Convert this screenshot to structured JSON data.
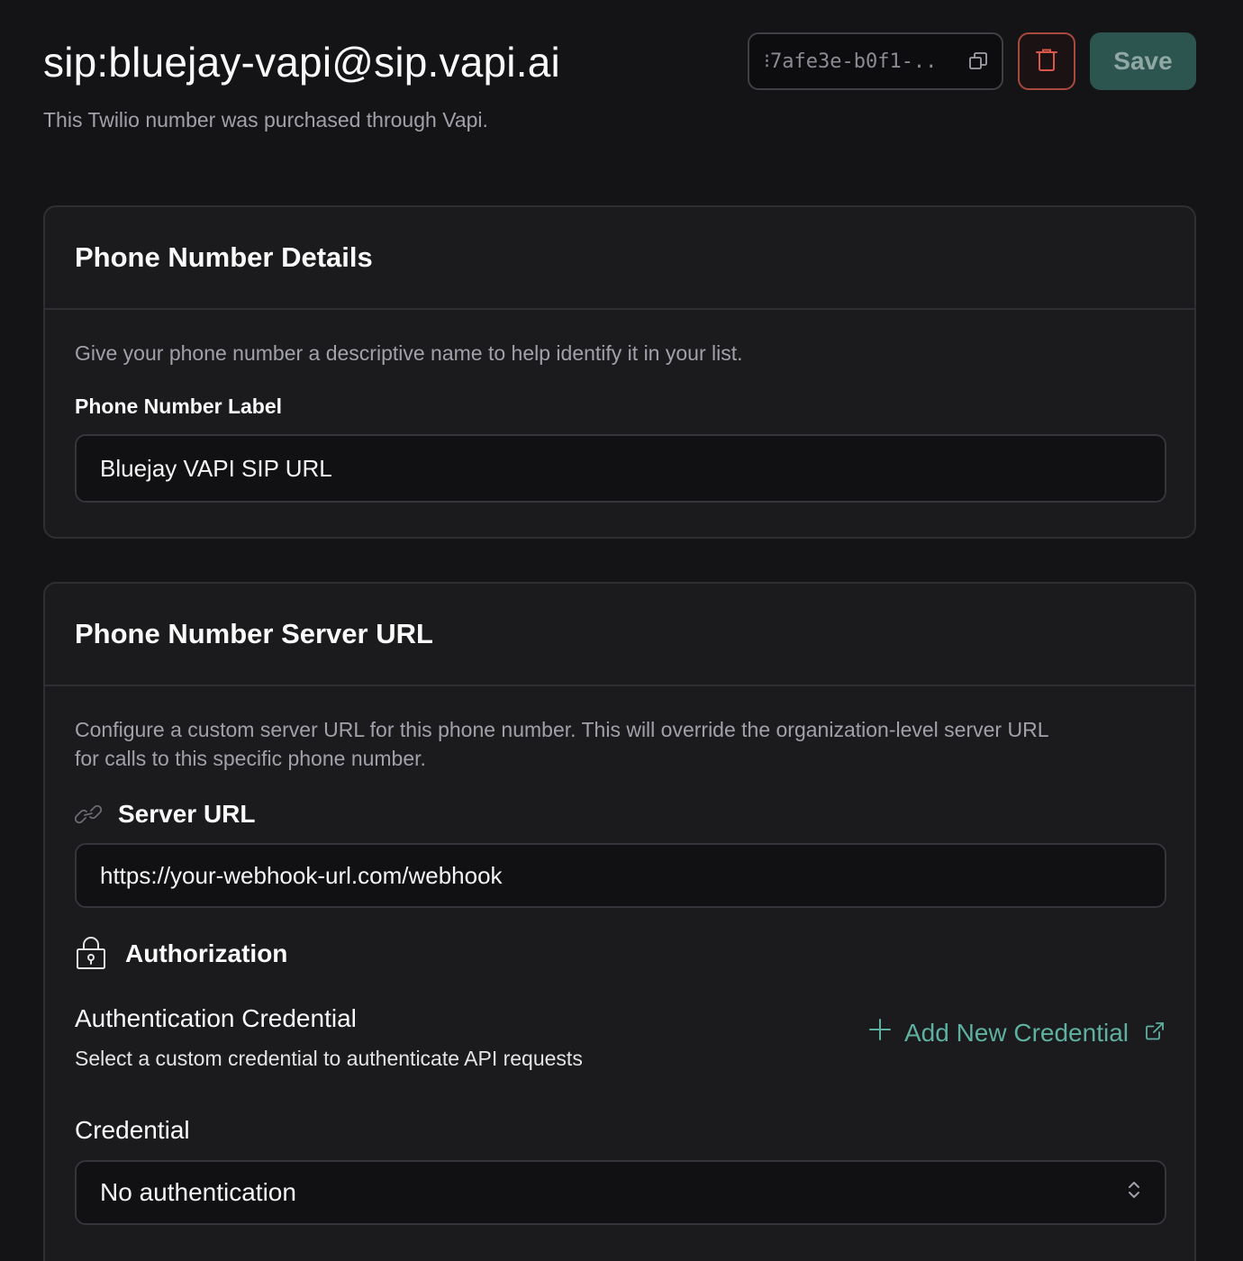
{
  "header": {
    "title": "sip:bluejay-vapi@sip.vapi.ai",
    "subtitle": "This Twilio number was purchased through Vapi.",
    "id_value": "⁝7afe3e-b0f1-..",
    "save_label": "Save"
  },
  "details_card": {
    "title": "Phone Number Details",
    "description": "Give your phone number a descriptive name to help identify it in your list.",
    "label_field_label": "Phone Number Label",
    "label_field_value": "Bluejay VAPI SIP URL"
  },
  "server_card": {
    "title": "Phone Number Server URL",
    "description_line1": "Configure a custom server URL for this phone number. This will override the organization-level server URL",
    "description_line2": "for calls to this specific phone number.",
    "server_url_label": "Server URL",
    "server_url_placeholder": "https://your-webhook-url.com/webhook",
    "authorization_label": "Authorization",
    "auth_credential_title": "Authentication Credential",
    "auth_credential_desc": "Select a custom credential to authenticate API requests",
    "add_credential_label": "Add New Credential",
    "credential_label": "Credential",
    "credential_value": "No authentication"
  },
  "colors": {
    "background": "#141416",
    "card": "#1b1b1d",
    "accent": "#5eb0a0",
    "save_bg": "#2d5550",
    "danger": "#a8493f"
  },
  "icons": [
    "copy-icon",
    "trash-icon",
    "link-icon",
    "lock-icon",
    "plus-icon",
    "external-link-icon",
    "chevron-updown-icon"
  ]
}
